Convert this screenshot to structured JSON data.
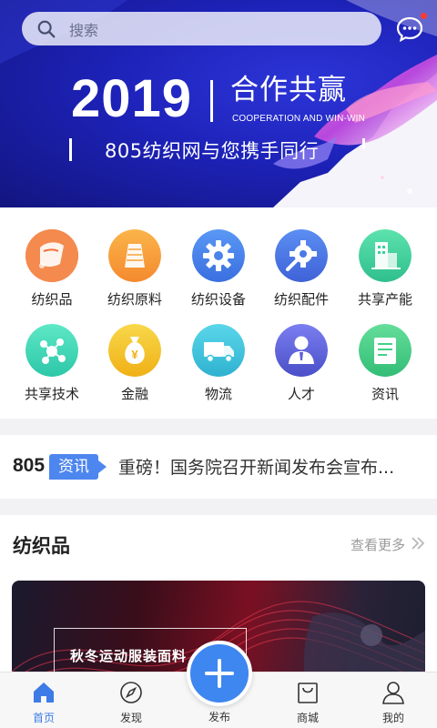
{
  "search": {
    "placeholder": "搜索"
  },
  "banner": {
    "year": "2019",
    "title_cn": "合作共赢",
    "title_en": "COOPERATION AND WIN-WIN",
    "subtitle": "805纺织网与您携手同行"
  },
  "categories": [
    {
      "label": "纺织品",
      "icon": "textile-icon",
      "color": "#f2703c"
    },
    {
      "label": "纺织原料",
      "icon": "raw-material-icon",
      "color": "#f7a23a"
    },
    {
      "label": "纺织设备",
      "icon": "gear-icon",
      "color": "#3f7ee9"
    },
    {
      "label": "纺织配件",
      "icon": "accessory-gear-icon",
      "color": "#4a79e8"
    },
    {
      "label": "共享产能",
      "icon": "factory-icon",
      "color": "#3fcf9e"
    },
    {
      "label": "共享技术",
      "icon": "tech-network-icon",
      "color": "#3fd7b8"
    },
    {
      "label": "金融",
      "icon": "money-bag-icon",
      "color": "#f3c224"
    },
    {
      "label": "物流",
      "icon": "truck-icon",
      "color": "#38c4dc"
    },
    {
      "label": "人才",
      "icon": "person-icon",
      "color": "#5b5fd8"
    },
    {
      "label": "资讯",
      "icon": "document-icon",
      "color": "#44d08a"
    }
  ],
  "news": {
    "brand_number": "805",
    "tag": "资讯",
    "headline": "重磅！国务院召开新闻发布会宣布..."
  },
  "section": {
    "title": "纺织品",
    "more": "查看更多",
    "promo_text": "秋冬运动服装面料"
  },
  "tabs": [
    {
      "label": "首页",
      "icon": "home-icon",
      "active": true
    },
    {
      "label": "发现",
      "icon": "compass-icon",
      "active": false
    },
    {
      "label": "发布",
      "icon": "plus-icon",
      "active": false
    },
    {
      "label": "商城",
      "icon": "shopping-bag-icon",
      "active": false
    },
    {
      "label": "我的",
      "icon": "user-icon",
      "active": false
    }
  ],
  "colors": {
    "accent": "#3e86f0",
    "banner_blue": "#1d22b8",
    "news_tag": "#4d86ee"
  }
}
